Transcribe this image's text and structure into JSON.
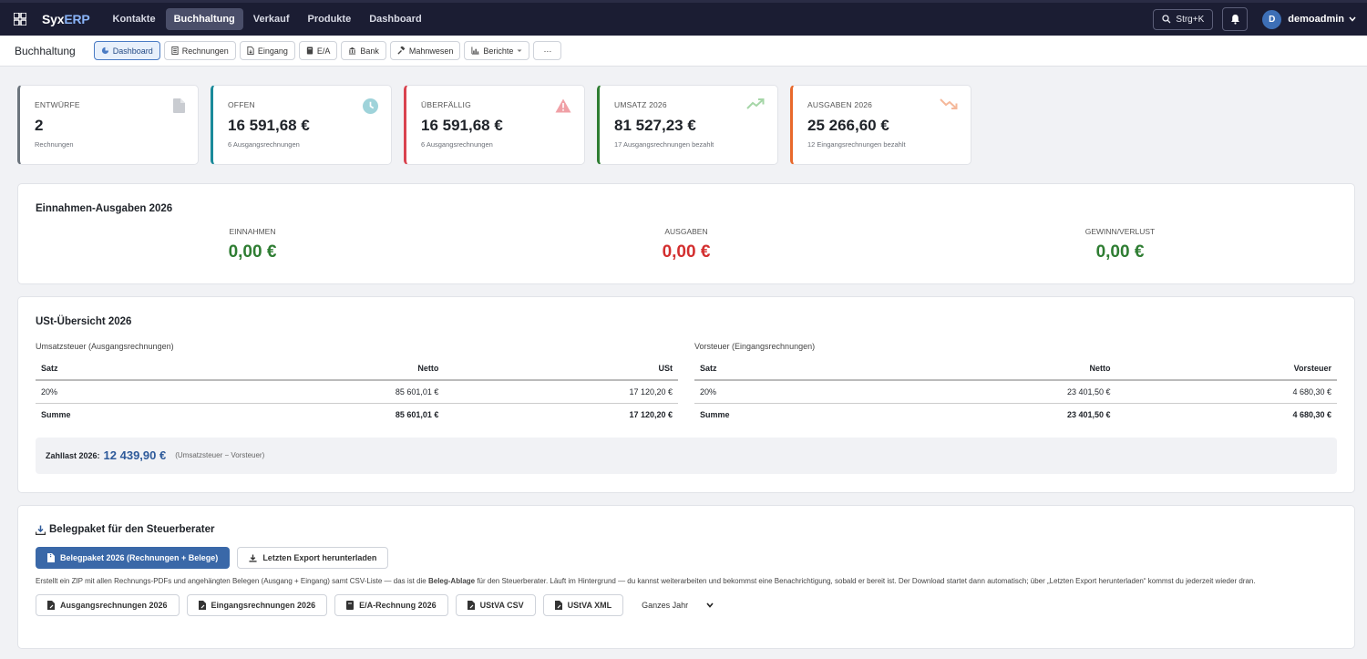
{
  "topbar": {
    "brand_a": "Syx",
    "brand_b": "ERP",
    "nav": [
      "Kontakte",
      "Buchhaltung",
      "Verkauf",
      "Produkte",
      "Dashboard"
    ],
    "search_label": "Strg+K",
    "avatar_initial": "D",
    "user": "demoadmin"
  },
  "subbar": {
    "title": "Buchhaltung",
    "buttons": [
      "Dashboard",
      "Rechnungen",
      "Eingang",
      "E/A",
      "Bank",
      "Mahnwesen",
      "Berichte",
      "···"
    ]
  },
  "stats": [
    {
      "label": "Entwürfe",
      "value": "2",
      "sub": "Rechnungen",
      "color": "#6c757d"
    },
    {
      "label": "Offen",
      "value": "16 591,68 €",
      "sub": "6 Ausgangsrechnungen",
      "color": "#1a8a9a"
    },
    {
      "label": "Überfällig",
      "value": "16 591,68 €",
      "sub": "6 Ausgangsrechnungen",
      "color": "#d9434f"
    },
    {
      "label": "Umsatz 2026",
      "value": "81 527,23 €",
      "sub": "17 Ausgangsrechnungen bezahlt",
      "color": "#2e7d32"
    },
    {
      "label": "Ausgaben 2026",
      "value": "25 266,60 €",
      "sub": "12 Eingangsrechnungen bezahlt",
      "color": "#e8692c"
    }
  ],
  "ea": {
    "title": "Einnahmen-Ausgaben 2026",
    "einnahmen_label": "Einnahmen",
    "einnahmen_value": "0,00 €",
    "ausgaben_label": "Ausgaben",
    "ausgaben_value": "0,00 €",
    "gewinn_label": "Gewinn/Verlust",
    "gewinn_value": "0,00 €"
  },
  "ust": {
    "title": "USt-Übersicht 2026",
    "left": {
      "subtitle": "Umsatzsteuer (Ausgangsrechnungen)",
      "headers": [
        "Satz",
        "Netto",
        "USt"
      ],
      "row": [
        "20%",
        "85 601,01 €",
        "17 120,20 €"
      ],
      "sum": [
        "Summe",
        "85 601,01 €",
        "17 120,20 €"
      ]
    },
    "right": {
      "subtitle": "Vorsteuer (Eingangsrechnungen)",
      "headers": [
        "Satz",
        "Netto",
        "Vorsteuer"
      ],
      "row": [
        "20%",
        "23 401,50 €",
        "4 680,30 €"
      ],
      "sum": [
        "Summe",
        "23 401,50 €",
        "4 680,30 €"
      ]
    },
    "zahllast_label": "Zahllast 2026:",
    "zahllast_value": "12 439,90 €",
    "zahllast_hint": "(Umsatzsteuer − Vorsteuer)"
  },
  "beleg": {
    "title": "Belegpaket für den Steuerberater",
    "primary_btn": "Belegpaket 2026 (Rechnungen + Belege)",
    "download_btn": "Letzten Export herunterladen",
    "desc_1": "Erstellt ein ZIP mit allen Rechnungs-PDFs und angehängten Belegen (Ausgang + Eingang) samt CSV-Liste — das ist die ",
    "desc_bold": "Beleg-Ablage",
    "desc_2": " für den Steuerberater. Läuft im Hintergrund — du kannst weiterarbeiten und bekommst eine Benachrichtigung, sobald er bereit ist. Der Download startet dann automatisch; über „Letzten Export herunterladen“ kommst du jederzeit wieder dran.",
    "exports": [
      "Ausgangsrechnungen 2026",
      "Eingangsrechnungen 2026",
      "E/A-Rechnung 2026",
      "UStVA CSV",
      "UStVA XML"
    ],
    "period": "Ganzes Jahr"
  }
}
